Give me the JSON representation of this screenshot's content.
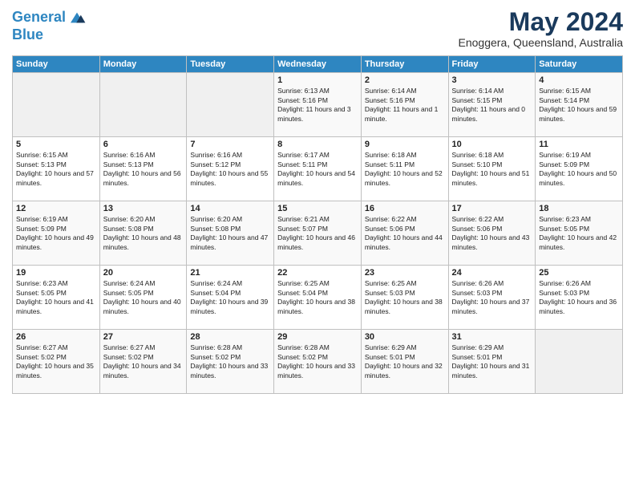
{
  "header": {
    "logo_line1": "General",
    "logo_line2": "Blue",
    "month": "May 2024",
    "location": "Enoggera, Queensland, Australia"
  },
  "days_of_week": [
    "Sunday",
    "Monday",
    "Tuesday",
    "Wednesday",
    "Thursday",
    "Friday",
    "Saturday"
  ],
  "weeks": [
    [
      {
        "day": "",
        "info": ""
      },
      {
        "day": "",
        "info": ""
      },
      {
        "day": "",
        "info": ""
      },
      {
        "day": "1",
        "info": "Sunrise: 6:13 AM\nSunset: 5:16 PM\nDaylight: 11 hours and 3 minutes."
      },
      {
        "day": "2",
        "info": "Sunrise: 6:14 AM\nSunset: 5:16 PM\nDaylight: 11 hours and 1 minute."
      },
      {
        "day": "3",
        "info": "Sunrise: 6:14 AM\nSunset: 5:15 PM\nDaylight: 11 hours and 0 minutes."
      },
      {
        "day": "4",
        "info": "Sunrise: 6:15 AM\nSunset: 5:14 PM\nDaylight: 10 hours and 59 minutes."
      }
    ],
    [
      {
        "day": "5",
        "info": "Sunrise: 6:15 AM\nSunset: 5:13 PM\nDaylight: 10 hours and 57 minutes."
      },
      {
        "day": "6",
        "info": "Sunrise: 6:16 AM\nSunset: 5:13 PM\nDaylight: 10 hours and 56 minutes."
      },
      {
        "day": "7",
        "info": "Sunrise: 6:16 AM\nSunset: 5:12 PM\nDaylight: 10 hours and 55 minutes."
      },
      {
        "day": "8",
        "info": "Sunrise: 6:17 AM\nSunset: 5:11 PM\nDaylight: 10 hours and 54 minutes."
      },
      {
        "day": "9",
        "info": "Sunrise: 6:18 AM\nSunset: 5:11 PM\nDaylight: 10 hours and 52 minutes."
      },
      {
        "day": "10",
        "info": "Sunrise: 6:18 AM\nSunset: 5:10 PM\nDaylight: 10 hours and 51 minutes."
      },
      {
        "day": "11",
        "info": "Sunrise: 6:19 AM\nSunset: 5:09 PM\nDaylight: 10 hours and 50 minutes."
      }
    ],
    [
      {
        "day": "12",
        "info": "Sunrise: 6:19 AM\nSunset: 5:09 PM\nDaylight: 10 hours and 49 minutes."
      },
      {
        "day": "13",
        "info": "Sunrise: 6:20 AM\nSunset: 5:08 PM\nDaylight: 10 hours and 48 minutes."
      },
      {
        "day": "14",
        "info": "Sunrise: 6:20 AM\nSunset: 5:08 PM\nDaylight: 10 hours and 47 minutes."
      },
      {
        "day": "15",
        "info": "Sunrise: 6:21 AM\nSunset: 5:07 PM\nDaylight: 10 hours and 46 minutes."
      },
      {
        "day": "16",
        "info": "Sunrise: 6:22 AM\nSunset: 5:06 PM\nDaylight: 10 hours and 44 minutes."
      },
      {
        "day": "17",
        "info": "Sunrise: 6:22 AM\nSunset: 5:06 PM\nDaylight: 10 hours and 43 minutes."
      },
      {
        "day": "18",
        "info": "Sunrise: 6:23 AM\nSunset: 5:05 PM\nDaylight: 10 hours and 42 minutes."
      }
    ],
    [
      {
        "day": "19",
        "info": "Sunrise: 6:23 AM\nSunset: 5:05 PM\nDaylight: 10 hours and 41 minutes."
      },
      {
        "day": "20",
        "info": "Sunrise: 6:24 AM\nSunset: 5:05 PM\nDaylight: 10 hours and 40 minutes."
      },
      {
        "day": "21",
        "info": "Sunrise: 6:24 AM\nSunset: 5:04 PM\nDaylight: 10 hours and 39 minutes."
      },
      {
        "day": "22",
        "info": "Sunrise: 6:25 AM\nSunset: 5:04 PM\nDaylight: 10 hours and 38 minutes."
      },
      {
        "day": "23",
        "info": "Sunrise: 6:25 AM\nSunset: 5:03 PM\nDaylight: 10 hours and 38 minutes."
      },
      {
        "day": "24",
        "info": "Sunrise: 6:26 AM\nSunset: 5:03 PM\nDaylight: 10 hours and 37 minutes."
      },
      {
        "day": "25",
        "info": "Sunrise: 6:26 AM\nSunset: 5:03 PM\nDaylight: 10 hours and 36 minutes."
      }
    ],
    [
      {
        "day": "26",
        "info": "Sunrise: 6:27 AM\nSunset: 5:02 PM\nDaylight: 10 hours and 35 minutes."
      },
      {
        "day": "27",
        "info": "Sunrise: 6:27 AM\nSunset: 5:02 PM\nDaylight: 10 hours and 34 minutes."
      },
      {
        "day": "28",
        "info": "Sunrise: 6:28 AM\nSunset: 5:02 PM\nDaylight: 10 hours and 33 minutes."
      },
      {
        "day": "29",
        "info": "Sunrise: 6:28 AM\nSunset: 5:02 PM\nDaylight: 10 hours and 33 minutes."
      },
      {
        "day": "30",
        "info": "Sunrise: 6:29 AM\nSunset: 5:01 PM\nDaylight: 10 hours and 32 minutes."
      },
      {
        "day": "31",
        "info": "Sunrise: 6:29 AM\nSunset: 5:01 PM\nDaylight: 10 hours and 31 minutes."
      },
      {
        "day": "",
        "info": ""
      }
    ]
  ]
}
